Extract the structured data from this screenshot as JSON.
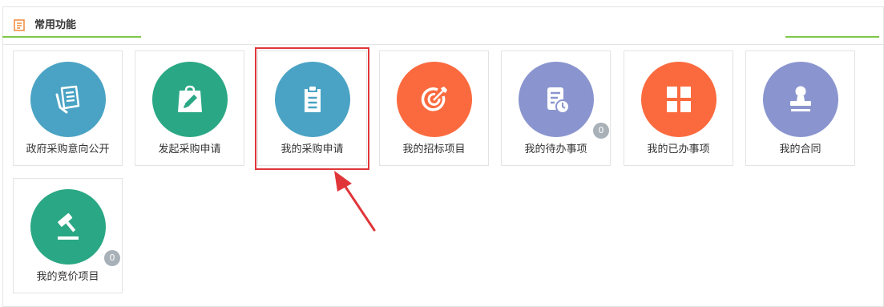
{
  "header": {
    "title": "常用功能",
    "icon": "clipboard-icon",
    "icon_color": "#f08a3c",
    "accent_color": "#7cc84a"
  },
  "tiles": [
    {
      "label": "政府采购意向公开",
      "icon": "document-list-icon",
      "color": "#4aa3c4"
    },
    {
      "label": "发起采购申请",
      "icon": "bag-edit-icon",
      "color": "#2aa784"
    },
    {
      "label": "我的采购申请",
      "icon": "clipboard-list-icon",
      "color": "#4aa3c4"
    },
    {
      "label": "我的招标项目",
      "icon": "target-icon",
      "color": "#fb6a3e"
    },
    {
      "label": "我的待办事项",
      "icon": "document-clock-icon",
      "color": "#8a95cf",
      "badge": "0"
    },
    {
      "label": "我的已办事项",
      "icon": "grid-icon",
      "color": "#fb6a3e"
    },
    {
      "label": "我的合同",
      "icon": "seal-stamp-icon",
      "color": "#8a95cf"
    },
    {
      "label": "我的竞价项目",
      "icon": "gavel-icon",
      "color": "#2aa784",
      "badge": "0"
    }
  ],
  "badge_color": "#a9b1b8",
  "highlight_color": "#e0363a"
}
